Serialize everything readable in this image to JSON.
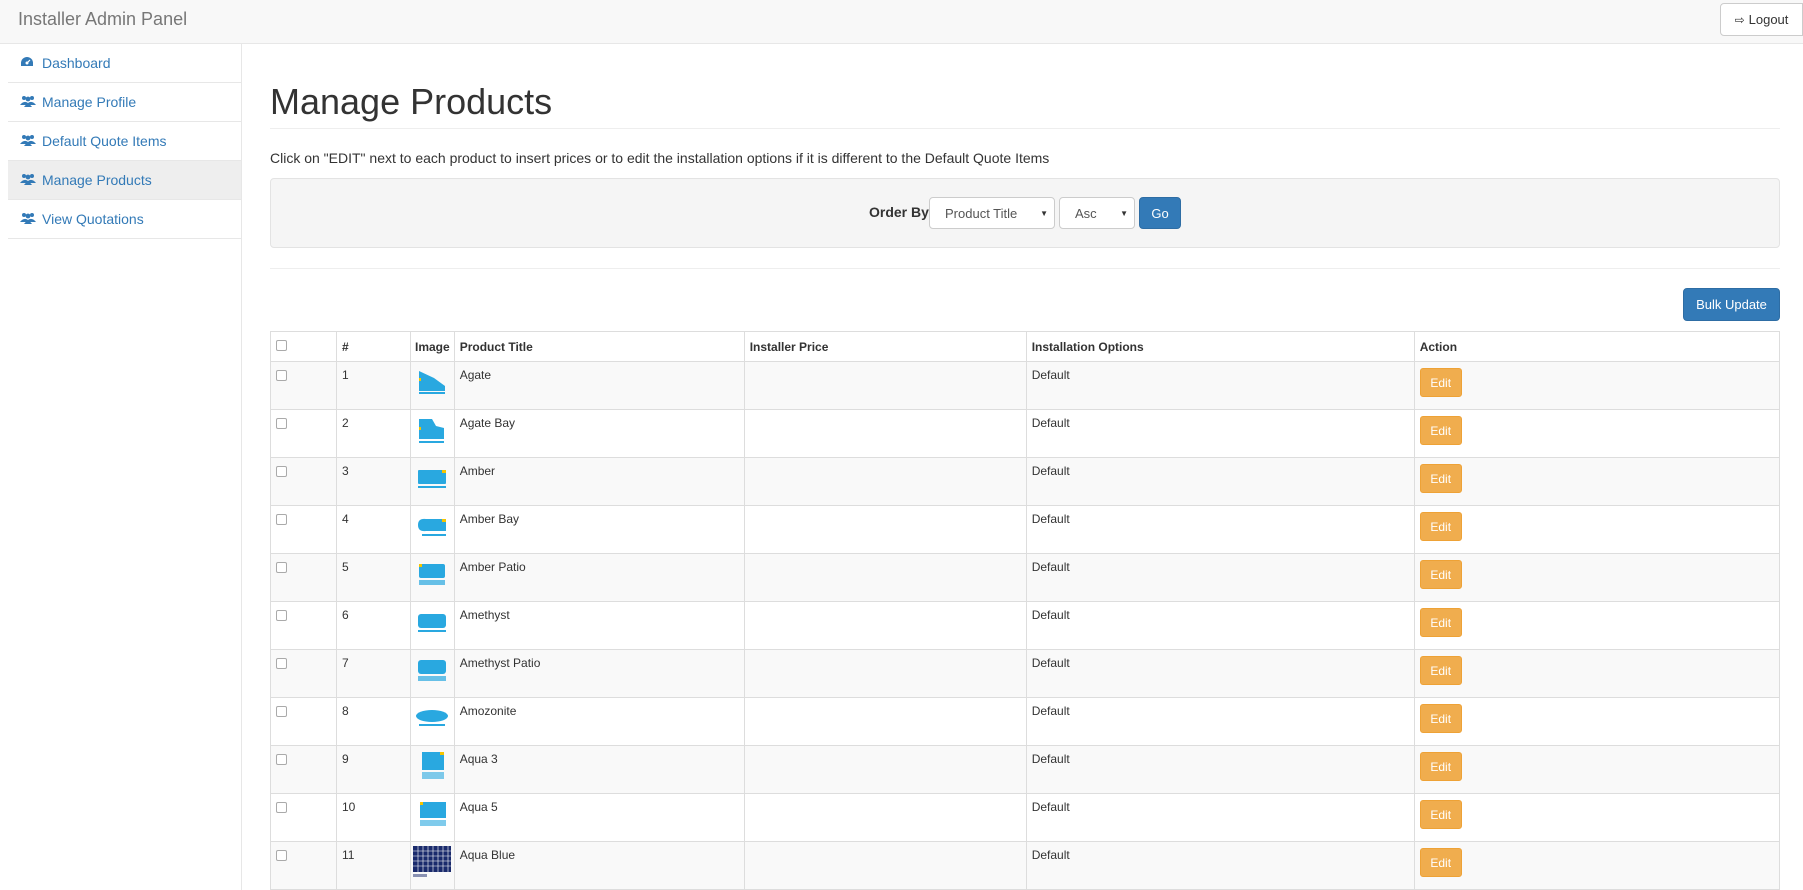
{
  "header": {
    "brand": "Installer Admin Panel",
    "logout_label": "Logout"
  },
  "sidebar": {
    "items": [
      {
        "label": "Dashboard",
        "icon": "dashboard-icon"
      },
      {
        "label": "Manage Profile",
        "icon": "users-icon"
      },
      {
        "label": "Default Quote Items",
        "icon": "users-icon"
      },
      {
        "label": "Manage Products",
        "icon": "users-icon",
        "active": true
      },
      {
        "label": "View Quotations",
        "icon": "users-icon"
      }
    ]
  },
  "main": {
    "title": "Manage Products",
    "instructions": "Click on \"EDIT\" next to each product to insert prices or to edit the installation options if it is different to the Default Quote Items",
    "filter": {
      "order_by_label": "Order By",
      "field_selected": "Product Title",
      "direction_selected": "Asc",
      "go_label": "Go"
    },
    "bulk_update_label": "Bulk Update",
    "table": {
      "headers": {
        "num": "#",
        "image": "Image",
        "title": "Product Title",
        "price": "Installer Price",
        "options": "Installation Options",
        "action": "Action"
      },
      "edit_label": "Edit",
      "rows": [
        {
          "num": "1",
          "title": "Agate",
          "price": "",
          "options": "Default"
        },
        {
          "num": "2",
          "title": "Agate Bay",
          "price": "",
          "options": "Default"
        },
        {
          "num": "3",
          "title": "Amber",
          "price": "",
          "options": "Default"
        },
        {
          "num": "4",
          "title": "Amber Bay",
          "price": "",
          "options": "Default"
        },
        {
          "num": "5",
          "title": "Amber Patio",
          "price": "",
          "options": "Default"
        },
        {
          "num": "6",
          "title": "Amethyst",
          "price": "",
          "options": "Default"
        },
        {
          "num": "7",
          "title": "Amethyst Patio",
          "price": "",
          "options": "Default"
        },
        {
          "num": "8",
          "title": "Amozonite",
          "price": "",
          "options": "Default"
        },
        {
          "num": "9",
          "title": "Aqua 3",
          "price": "",
          "options": "Default"
        },
        {
          "num": "10",
          "title": "Aqua 5",
          "price": "",
          "options": "Default"
        },
        {
          "num": "11",
          "title": "Aqua Blue",
          "price": "",
          "options": "Default"
        }
      ]
    }
  },
  "colors": {
    "link": "#337ab7",
    "primary_button": "#337ab7",
    "edit_button": "#f0ad4e",
    "thumbnail_pool": "#29a8e0"
  }
}
